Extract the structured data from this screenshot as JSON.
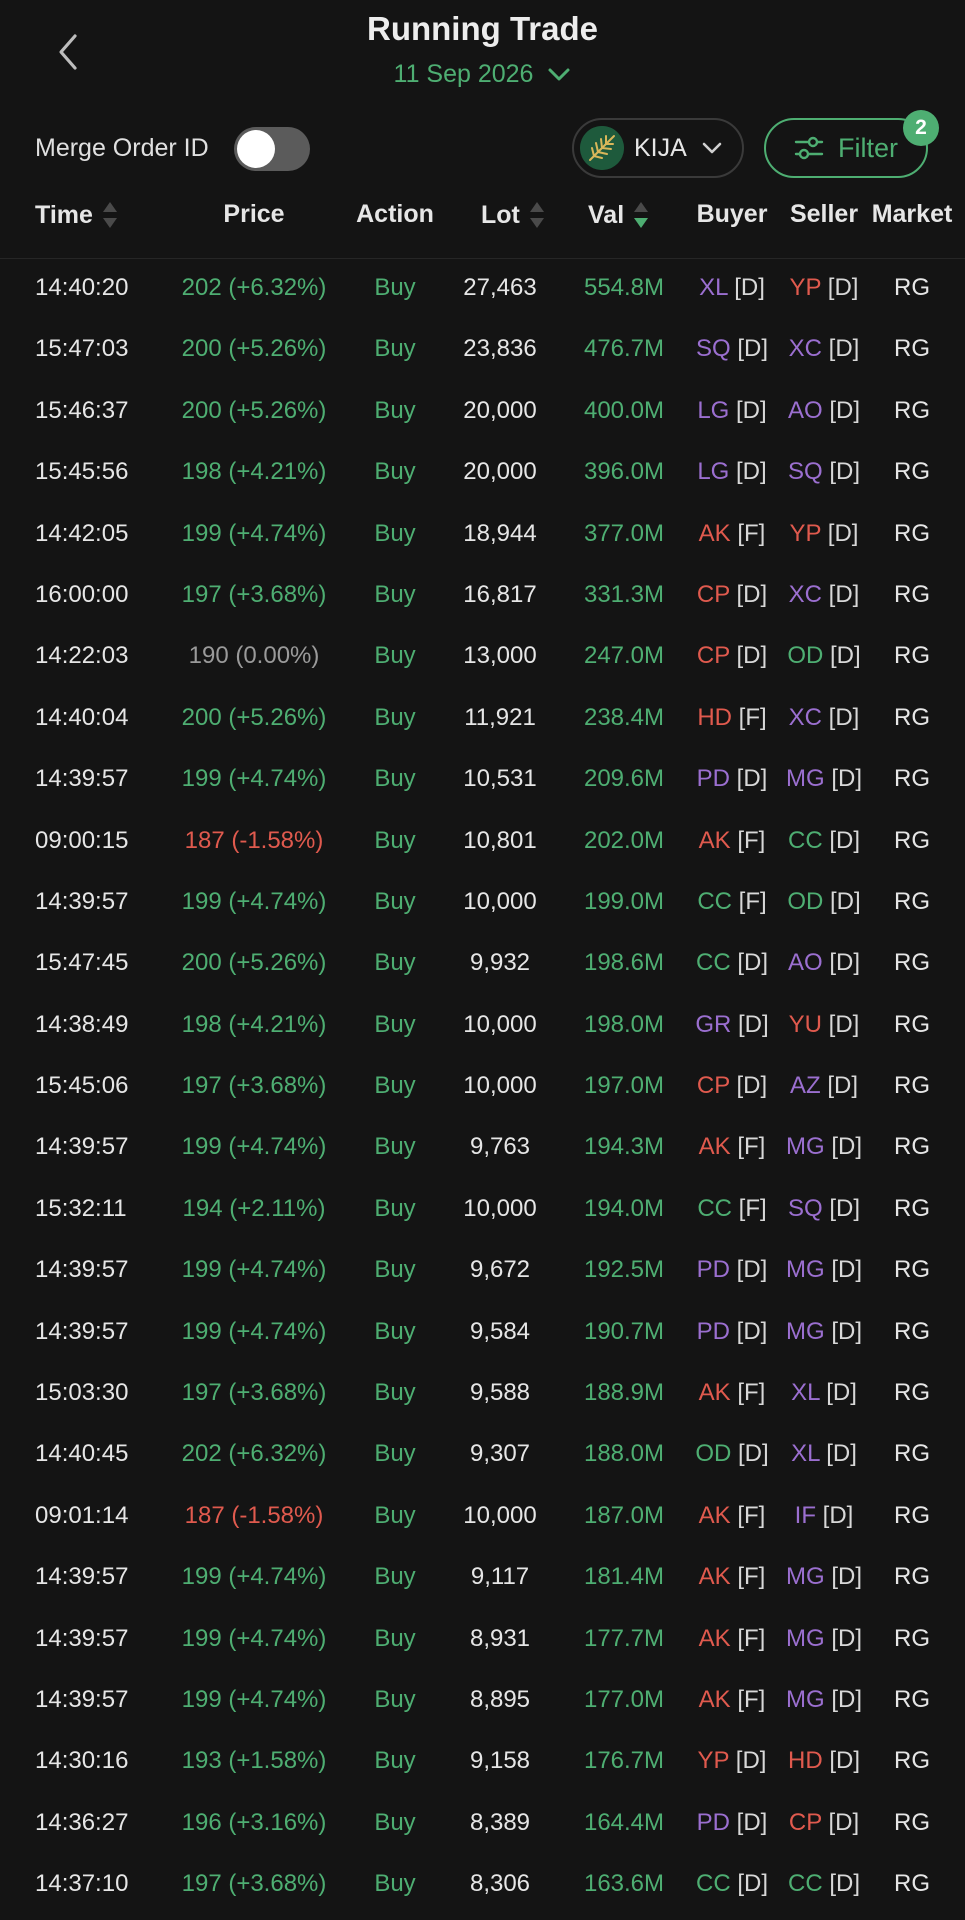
{
  "header": {
    "title": "Running Trade",
    "date": "11 Sep 2026",
    "icons": {
      "back": "chevron-left-icon",
      "date": "chevron-down-icon"
    }
  },
  "controls": {
    "merge_label": "Merge Order ID",
    "merge_on": false,
    "stock_code": "KIJA",
    "filter_label": "Filter",
    "filter_count": "2"
  },
  "columns": {
    "time": "Time",
    "price": "Price",
    "action": "Action",
    "lot": "Lot",
    "val": "Val",
    "buyer": "Buyer",
    "seller": "Seller",
    "market": "Market"
  },
  "colors": {
    "up": "#4eae72",
    "down": "#e05a4e",
    "flat": "#9a9a9a",
    "broker_purple": "#9b6fd0",
    "broker_red": "#e05a4e",
    "broker_green": "#4eae72",
    "background": "#141414"
  },
  "trades": [
    {
      "time": "14:40:20",
      "price": "202 (+6.32%)",
      "dir": "up",
      "action": "Buy",
      "lot": "27,463",
      "val": "554.8M",
      "buyer": "XL",
      "buyer_color": "purple",
      "buyer_type": "[D]",
      "seller": "YP",
      "seller_color": "red",
      "seller_type": "[D]",
      "market": "RG"
    },
    {
      "time": "15:47:03",
      "price": "200 (+5.26%)",
      "dir": "up",
      "action": "Buy",
      "lot": "23,836",
      "val": "476.7M",
      "buyer": "SQ",
      "buyer_color": "purple",
      "buyer_type": "[D]",
      "seller": "XC",
      "seller_color": "purple",
      "seller_type": "[D]",
      "market": "RG"
    },
    {
      "time": "15:46:37",
      "price": "200 (+5.26%)",
      "dir": "up",
      "action": "Buy",
      "lot": "20,000",
      "val": "400.0M",
      "buyer": "LG",
      "buyer_color": "purple",
      "buyer_type": "[D]",
      "seller": "AO",
      "seller_color": "purple",
      "seller_type": "[D]",
      "market": "RG"
    },
    {
      "time": "15:45:56",
      "price": "198 (+4.21%)",
      "dir": "up",
      "action": "Buy",
      "lot": "20,000",
      "val": "396.0M",
      "buyer": "LG",
      "buyer_color": "purple",
      "buyer_type": "[D]",
      "seller": "SQ",
      "seller_color": "purple",
      "seller_type": "[D]",
      "market": "RG"
    },
    {
      "time": "14:42:05",
      "price": "199 (+4.74%)",
      "dir": "up",
      "action": "Buy",
      "lot": "18,944",
      "val": "377.0M",
      "buyer": "AK",
      "buyer_color": "red",
      "buyer_type": "[F]",
      "seller": "YP",
      "seller_color": "red",
      "seller_type": "[D]",
      "market": "RG"
    },
    {
      "time": "16:00:00",
      "price": "197 (+3.68%)",
      "dir": "up",
      "action": "Buy",
      "lot": "16,817",
      "val": "331.3M",
      "buyer": "CP",
      "buyer_color": "red",
      "buyer_type": "[D]",
      "seller": "XC",
      "seller_color": "purple",
      "seller_type": "[D]",
      "market": "RG"
    },
    {
      "time": "14:22:03",
      "price": "190 (0.00%)",
      "dir": "flat",
      "action": "Buy",
      "lot": "13,000",
      "val": "247.0M",
      "buyer": "CP",
      "buyer_color": "red",
      "buyer_type": "[D]",
      "seller": "OD",
      "seller_color": "green",
      "seller_type": "[D]",
      "market": "RG"
    },
    {
      "time": "14:40:04",
      "price": "200 (+5.26%)",
      "dir": "up",
      "action": "Buy",
      "lot": "11,921",
      "val": "238.4M",
      "buyer": "HD",
      "buyer_color": "red",
      "buyer_type": "[F]",
      "seller": "XC",
      "seller_color": "purple",
      "seller_type": "[D]",
      "market": "RG"
    },
    {
      "time": "14:39:57",
      "price": "199 (+4.74%)",
      "dir": "up",
      "action": "Buy",
      "lot": "10,531",
      "val": "209.6M",
      "buyer": "PD",
      "buyer_color": "purple",
      "buyer_type": "[D]",
      "seller": "MG",
      "seller_color": "purple",
      "seller_type": "[D]",
      "market": "RG"
    },
    {
      "time": "09:00:15",
      "price": "187 (-1.58%)",
      "dir": "down",
      "action": "Buy",
      "lot": "10,801",
      "val": "202.0M",
      "buyer": "AK",
      "buyer_color": "red",
      "buyer_type": "[F]",
      "seller": "CC",
      "seller_color": "green",
      "seller_type": "[D]",
      "market": "RG"
    },
    {
      "time": "14:39:57",
      "price": "199 (+4.74%)",
      "dir": "up",
      "action": "Buy",
      "lot": "10,000",
      "val": "199.0M",
      "buyer": "CC",
      "buyer_color": "green",
      "buyer_type": "[F]",
      "seller": "OD",
      "seller_color": "green",
      "seller_type": "[D]",
      "market": "RG"
    },
    {
      "time": "15:47:45",
      "price": "200 (+5.26%)",
      "dir": "up",
      "action": "Buy",
      "lot": "9,932",
      "val": "198.6M",
      "buyer": "CC",
      "buyer_color": "green",
      "buyer_type": "[D]",
      "seller": "AO",
      "seller_color": "purple",
      "seller_type": "[D]",
      "market": "RG"
    },
    {
      "time": "14:38:49",
      "price": "198 (+4.21%)",
      "dir": "up",
      "action": "Buy",
      "lot": "10,000",
      "val": "198.0M",
      "buyer": "GR",
      "buyer_color": "purple",
      "buyer_type": "[D]",
      "seller": "YU",
      "seller_color": "red",
      "seller_type": "[D]",
      "market": "RG"
    },
    {
      "time": "15:45:06",
      "price": "197 (+3.68%)",
      "dir": "up",
      "action": "Buy",
      "lot": "10,000",
      "val": "197.0M",
      "buyer": "CP",
      "buyer_color": "red",
      "buyer_type": "[D]",
      "seller": "AZ",
      "seller_color": "purple",
      "seller_type": "[D]",
      "market": "RG"
    },
    {
      "time": "14:39:57",
      "price": "199 (+4.74%)",
      "dir": "up",
      "action": "Buy",
      "lot": "9,763",
      "val": "194.3M",
      "buyer": "AK",
      "buyer_color": "red",
      "buyer_type": "[F]",
      "seller": "MG",
      "seller_color": "purple",
      "seller_type": "[D]",
      "market": "RG"
    },
    {
      "time": "15:32:11",
      "price": "194 (+2.11%)",
      "dir": "up",
      "action": "Buy",
      "lot": "10,000",
      "val": "194.0M",
      "buyer": "CC",
      "buyer_color": "green",
      "buyer_type": "[F]",
      "seller": "SQ",
      "seller_color": "purple",
      "seller_type": "[D]",
      "market": "RG"
    },
    {
      "time": "14:39:57",
      "price": "199 (+4.74%)",
      "dir": "up",
      "action": "Buy",
      "lot": "9,672",
      "val": "192.5M",
      "buyer": "PD",
      "buyer_color": "purple",
      "buyer_type": "[D]",
      "seller": "MG",
      "seller_color": "purple",
      "seller_type": "[D]",
      "market": "RG"
    },
    {
      "time": "14:39:57",
      "price": "199 (+4.74%)",
      "dir": "up",
      "action": "Buy",
      "lot": "9,584",
      "val": "190.7M",
      "buyer": "PD",
      "buyer_color": "purple",
      "buyer_type": "[D]",
      "seller": "MG",
      "seller_color": "purple",
      "seller_type": "[D]",
      "market": "RG"
    },
    {
      "time": "15:03:30",
      "price": "197 (+3.68%)",
      "dir": "up",
      "action": "Buy",
      "lot": "9,588",
      "val": "188.9M",
      "buyer": "AK",
      "buyer_color": "red",
      "buyer_type": "[F]",
      "seller": "XL",
      "seller_color": "purple",
      "seller_type": "[D]",
      "market": "RG"
    },
    {
      "time": "14:40:45",
      "price": "202 (+6.32%)",
      "dir": "up",
      "action": "Buy",
      "lot": "9,307",
      "val": "188.0M",
      "buyer": "OD",
      "buyer_color": "green",
      "buyer_type": "[D]",
      "seller": "XL",
      "seller_color": "purple",
      "seller_type": "[D]",
      "market": "RG"
    },
    {
      "time": "09:01:14",
      "price": "187 (-1.58%)",
      "dir": "down",
      "action": "Buy",
      "lot": "10,000",
      "val": "187.0M",
      "buyer": "AK",
      "buyer_color": "red",
      "buyer_type": "[F]",
      "seller": "IF",
      "seller_color": "purple",
      "seller_type": "[D]",
      "market": "RG"
    },
    {
      "time": "14:39:57",
      "price": "199 (+4.74%)",
      "dir": "up",
      "action": "Buy",
      "lot": "9,117",
      "val": "181.4M",
      "buyer": "AK",
      "buyer_color": "red",
      "buyer_type": "[F]",
      "seller": "MG",
      "seller_color": "purple",
      "seller_type": "[D]",
      "market": "RG"
    },
    {
      "time": "14:39:57",
      "price": "199 (+4.74%)",
      "dir": "up",
      "action": "Buy",
      "lot": "8,931",
      "val": "177.7M",
      "buyer": "AK",
      "buyer_color": "red",
      "buyer_type": "[F]",
      "seller": "MG",
      "seller_color": "purple",
      "seller_type": "[D]",
      "market": "RG"
    },
    {
      "time": "14:39:57",
      "price": "199 (+4.74%)",
      "dir": "up",
      "action": "Buy",
      "lot": "8,895",
      "val": "177.0M",
      "buyer": "AK",
      "buyer_color": "red",
      "buyer_type": "[F]",
      "seller": "MG",
      "seller_color": "purple",
      "seller_type": "[D]",
      "market": "RG"
    },
    {
      "time": "14:30:16",
      "price": "193 (+1.58%)",
      "dir": "up",
      "action": "Buy",
      "lot": "9,158",
      "val": "176.7M",
      "buyer": "YP",
      "buyer_color": "red",
      "buyer_type": "[D]",
      "seller": "HD",
      "seller_color": "red",
      "seller_type": "[D]",
      "market": "RG"
    },
    {
      "time": "14:36:27",
      "price": "196 (+3.16%)",
      "dir": "up",
      "action": "Buy",
      "lot": "8,389",
      "val": "164.4M",
      "buyer": "PD",
      "buyer_color": "purple",
      "buyer_type": "[D]",
      "seller": "CP",
      "seller_color": "red",
      "seller_type": "[D]",
      "market": "RG"
    },
    {
      "time": "14:37:10",
      "price": "197 (+3.68%)",
      "dir": "up",
      "action": "Buy",
      "lot": "8,306",
      "val": "163.6M",
      "buyer": "CC",
      "buyer_color": "green",
      "buyer_type": "[D]",
      "seller": "CC",
      "seller_color": "green",
      "seller_type": "[D]",
      "market": "RG"
    }
  ]
}
